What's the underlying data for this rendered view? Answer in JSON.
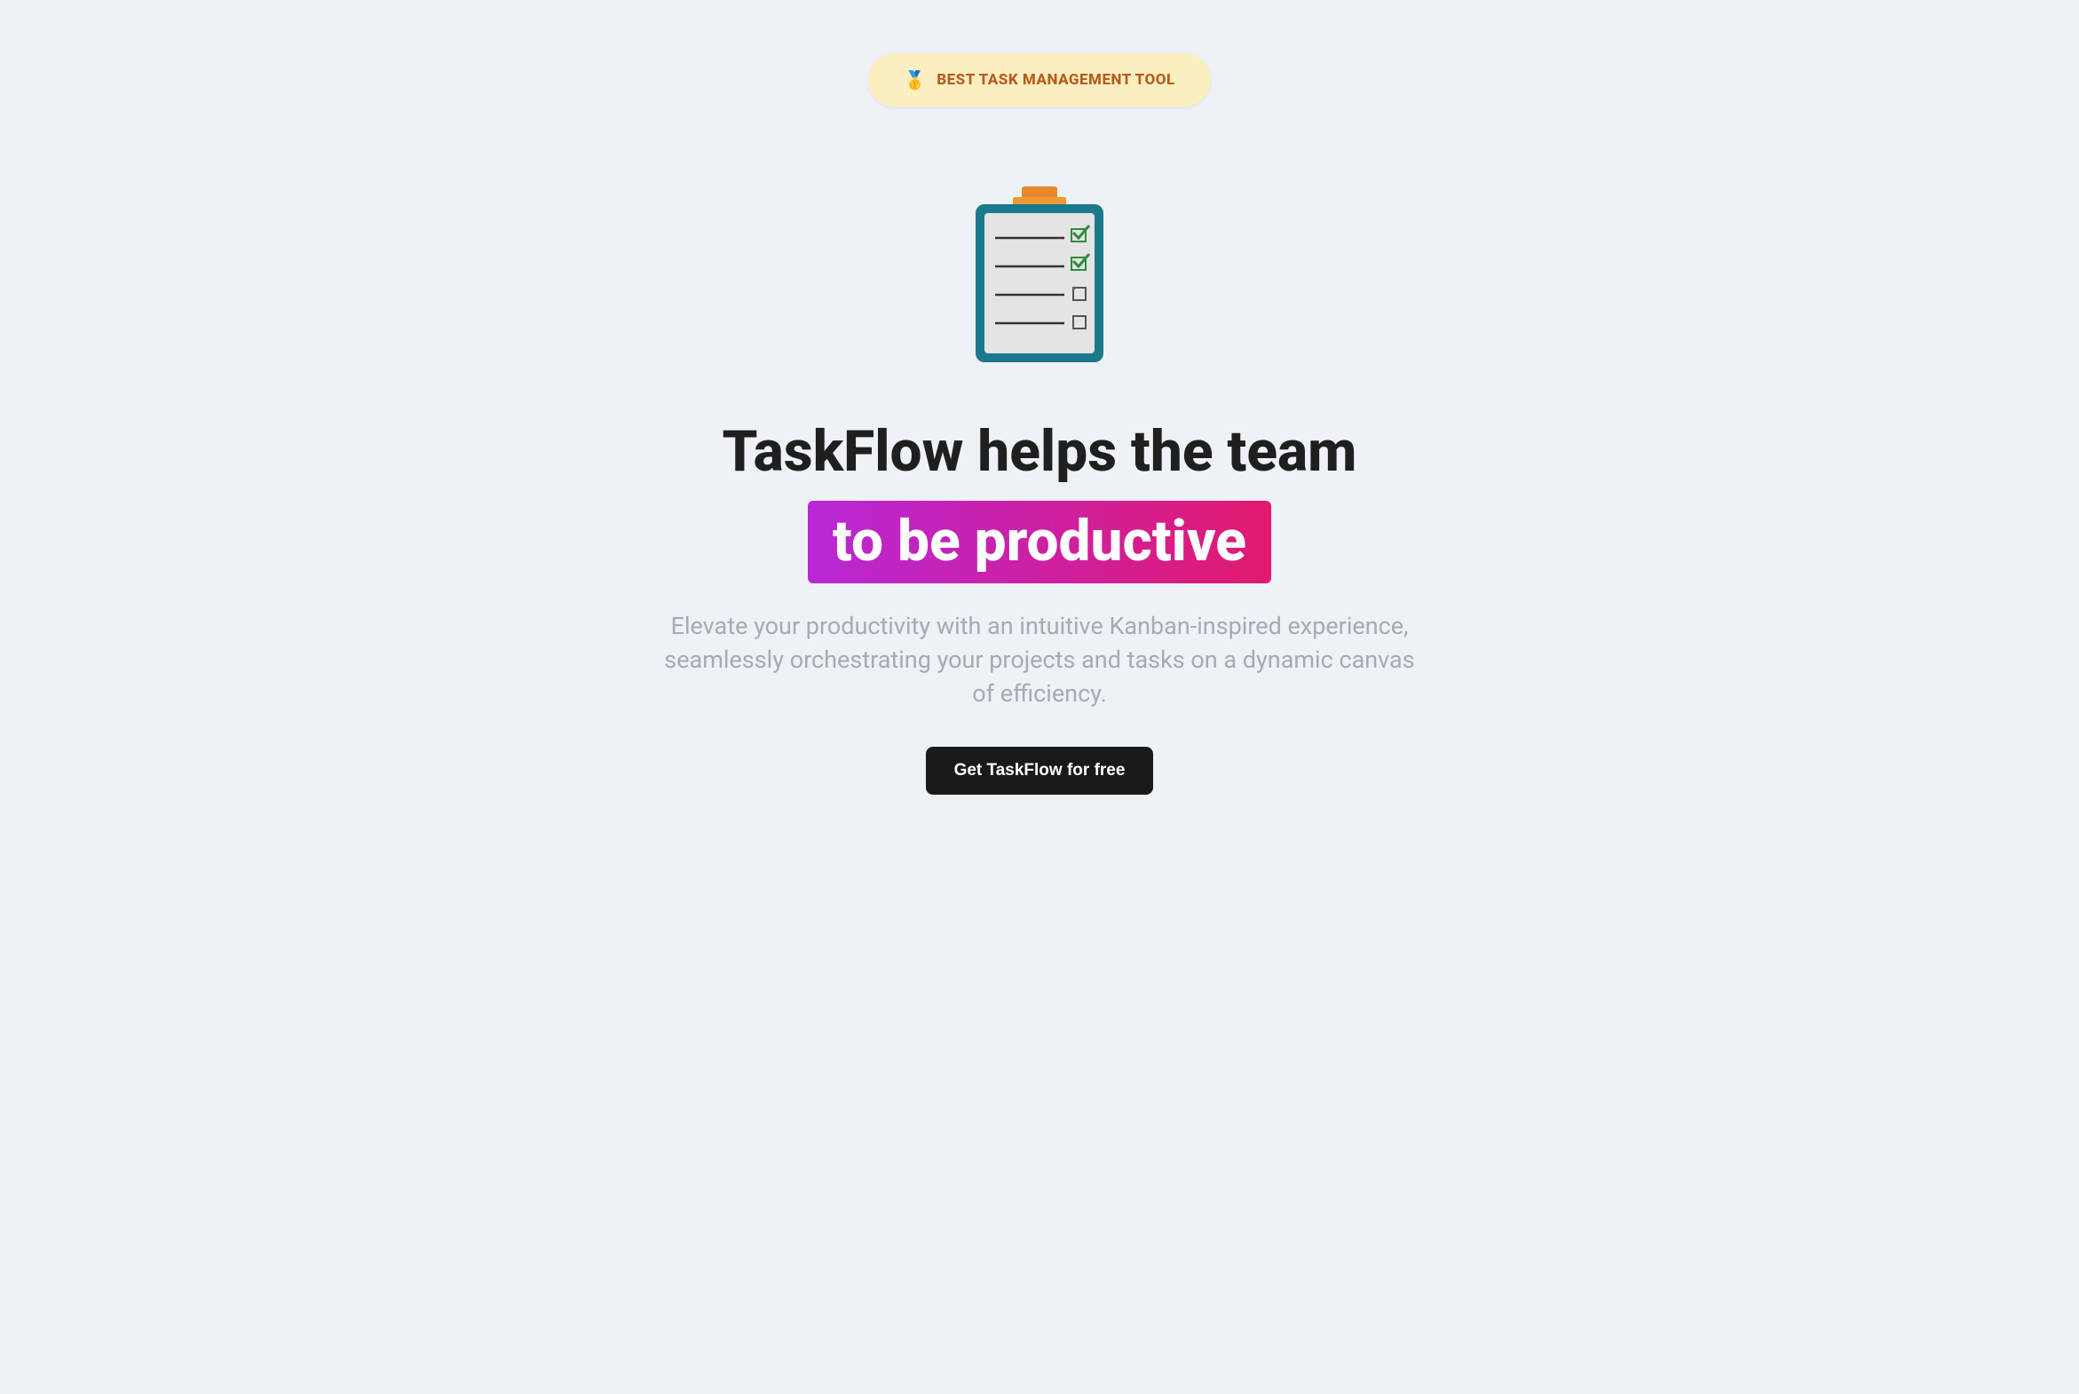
{
  "badge": {
    "icon": "🥇",
    "text": "BEST TASK MANAGEMENT TOOL"
  },
  "headline": {
    "line1": "TaskFlow helps the team",
    "line2": "to be productive"
  },
  "subtitle": "Elevate your productivity with an intuitive Kanban-inspired experience, seamlessly orchestrating your projects and tasks on a dynamic canvas of efficiency.",
  "cta": {
    "label": "Get TaskFlow for free"
  }
}
